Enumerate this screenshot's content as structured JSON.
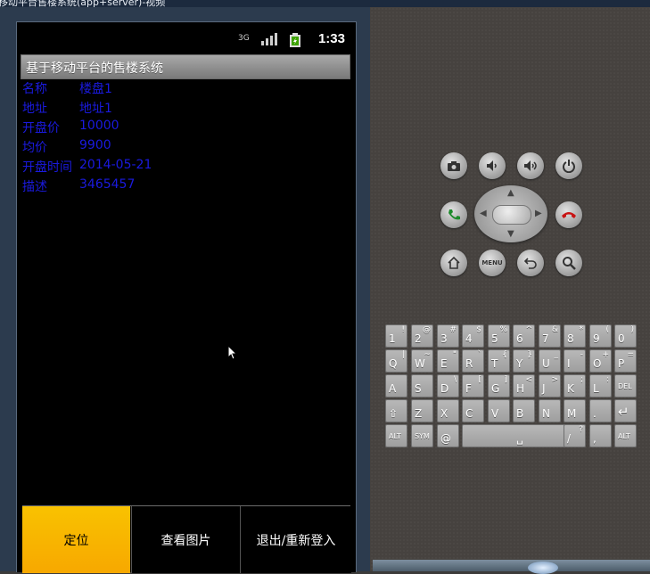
{
  "window": {
    "title": "移动平台售楼系统(app+server)-视频"
  },
  "status_bar": {
    "network": "3G",
    "time": "1:33"
  },
  "app": {
    "title": "基于移动平台的售楼系统",
    "details": [
      {
        "label": "名称",
        "value": "楼盘1"
      },
      {
        "label": "地址",
        "value": "地址1"
      },
      {
        "label": "开盘价",
        "value": "10000"
      },
      {
        "label": "均价",
        "value": "9900"
      },
      {
        "label": "开盘时间",
        "value": "2014-05-21"
      },
      {
        "label": "描述",
        "value": "3465457"
      }
    ],
    "tabs": [
      {
        "label": "定位",
        "active": true
      },
      {
        "label": "查看图片",
        "active": false
      },
      {
        "label": "退出/重新登入",
        "active": false
      }
    ]
  },
  "controls": {
    "menu_label": "MENU"
  },
  "keyboard": {
    "rows": [
      [
        {
          "main": "1",
          "alt": "!"
        },
        {
          "main": "2",
          "alt": "@"
        },
        {
          "main": "3",
          "alt": "#"
        },
        {
          "main": "4",
          "alt": "$"
        },
        {
          "main": "5",
          "alt": "%"
        },
        {
          "main": "6",
          "alt": "^"
        },
        {
          "main": "7",
          "alt": "&"
        },
        {
          "main": "8",
          "alt": "*"
        },
        {
          "main": "9",
          "alt": "("
        },
        {
          "main": "0",
          "alt": ")"
        }
      ],
      [
        {
          "main": "Q",
          "alt": "|"
        },
        {
          "main": "W",
          "alt": "~"
        },
        {
          "main": "E",
          "alt": "\""
        },
        {
          "main": "R",
          "alt": "`"
        },
        {
          "main": "T",
          "alt": "{"
        },
        {
          "main": "Y",
          "alt": "}"
        },
        {
          "main": "U",
          "alt": "_"
        },
        {
          "main": "I",
          "alt": "-"
        },
        {
          "main": "O",
          "alt": "+"
        },
        {
          "main": "P",
          "alt": "="
        }
      ],
      [
        {
          "main": "A",
          "alt": ""
        },
        {
          "main": "S",
          "alt": ""
        },
        {
          "main": "D",
          "alt": "\\"
        },
        {
          "main": "F",
          "alt": "["
        },
        {
          "main": "G",
          "alt": "]"
        },
        {
          "main": "H",
          "alt": "<"
        },
        {
          "main": "J",
          "alt": ">"
        },
        {
          "main": "K",
          "alt": ";"
        },
        {
          "main": "L",
          "alt": ":"
        },
        {
          "main": "DEL",
          "alt": ""
        }
      ],
      [
        {
          "main": "⇧",
          "alt": ""
        },
        {
          "main": "Z",
          "alt": ""
        },
        {
          "main": "X",
          "alt": ""
        },
        {
          "main": "C",
          "alt": ""
        },
        {
          "main": "V",
          "alt": ""
        },
        {
          "main": "B",
          "alt": ""
        },
        {
          "main": "N",
          "alt": ""
        },
        {
          "main": "M",
          "alt": ""
        },
        {
          "main": ".",
          "alt": ""
        },
        {
          "main": "↵",
          "alt": ""
        }
      ],
      [
        {
          "main": "ALT",
          "alt": ""
        },
        {
          "main": "SYM",
          "alt": ""
        },
        {
          "main": "@",
          "alt": ""
        },
        {
          "main": "␣",
          "alt": "→|"
        },
        {
          "main": "/",
          "alt": "?"
        },
        {
          "main": ",",
          "alt": ""
        },
        {
          "main": "ALT",
          "alt": ""
        }
      ]
    ]
  },
  "colors": {
    "detail_text": "#1a1adf",
    "active_tab": "#f7b500"
  }
}
